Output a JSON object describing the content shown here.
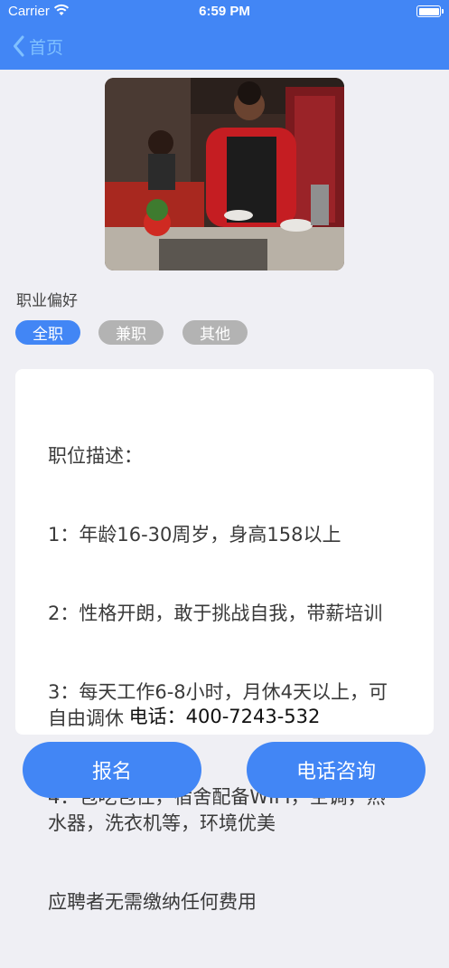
{
  "status_bar": {
    "carrier": "Carrier",
    "time": "6:59 PM"
  },
  "nav": {
    "back_label": "首页",
    "back_icon": "chevron-left-icon"
  },
  "preference": {
    "title": "职业偏好",
    "options": [
      {
        "label": "全职",
        "selected": true
      },
      {
        "label": "兼职",
        "selected": false
      },
      {
        "label": "其他",
        "selected": false
      }
    ]
  },
  "job": {
    "description_lines": [
      "职位描述：",
      "1：年龄16-30周岁，身高158以上",
      "2：性格开朗，敢于挑战自我，带薪培训",
      "3：每天工作6-8小时，月休4天以上，可自由调休",
      "4：包吃包住，宿舍配备WIFI，空调，热水器，洗衣机等，环境优美",
      "应聘者无需缴纳任何费用"
    ],
    "phone": "电话：400-7243-532"
  },
  "actions": {
    "apply_label": "报名",
    "call_label": "电话咨询"
  },
  "colors": {
    "primary": "#4286f5",
    "inactive_tag": "#b3b3b3",
    "background": "#efeff4"
  }
}
